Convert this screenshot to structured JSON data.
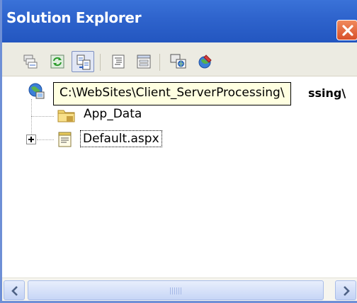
{
  "window": {
    "title": "Solution Explorer",
    "close_icon": "close-icon"
  },
  "toolbar": {
    "buttons": [
      {
        "name": "properties-button",
        "icon": "properties-icon"
      },
      {
        "name": "refresh-button",
        "icon": "refresh-icon"
      },
      {
        "name": "nest-related-files-button",
        "icon": "nest-files-icon",
        "pressed": true
      },
      {
        "name": "view-code-button",
        "icon": "view-code-icon"
      },
      {
        "name": "view-designer-button",
        "icon": "view-designer-icon"
      },
      {
        "name": "copy-website-button",
        "icon": "copy-website-icon"
      },
      {
        "name": "asp-net-configuration-button",
        "icon": "asp-net-config-icon"
      }
    ]
  },
  "tree": {
    "root": {
      "tooltip": "C:\\WebSites\\Client_ServerProcessing\\",
      "label_visible_tail": "ssing\\",
      "icon": "website-globe-icon"
    },
    "items": [
      {
        "label": "App_Data",
        "icon": "folder-icon"
      },
      {
        "label": "Default.aspx",
        "icon": "aspx-file-icon",
        "selected": true,
        "expandable": true
      }
    ]
  },
  "scrollbar": {
    "left_icon": "arrow-left-icon",
    "right_icon": "arrow-right-icon"
  },
  "colors": {
    "titlebar": "#2e63cc",
    "toolbar": "#ecebe2",
    "tooltip_bg": "#ffffe1",
    "close_button": "#e0602f"
  }
}
